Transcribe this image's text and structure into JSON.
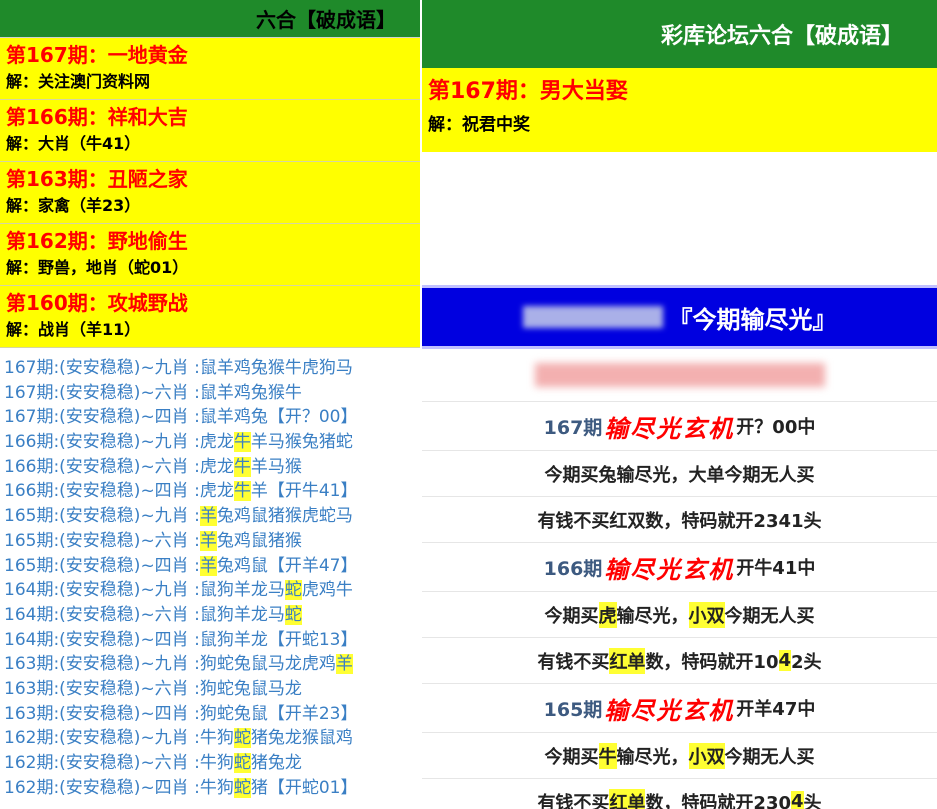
{
  "left": {
    "header": "六合【破成语】",
    "riddles": [
      {
        "title": "第167期：一地黄金",
        "answer": "解：关注澳门资料网"
      },
      {
        "title": "第166期：祥和大吉",
        "answer": "解：大肖（牛41）"
      },
      {
        "title": "第163期：丑陋之家",
        "answer": "解：家禽（羊23）"
      },
      {
        "title": "第162期：野地偷生",
        "answer": "解：野兽，地肖（蛇01）"
      },
      {
        "title": "第160期：攻城野战",
        "answer": "解：战肖（羊11）"
      }
    ],
    "list": [
      {
        "prefix": "167期:(安安稳稳)~九肖 :",
        "segments": [
          {
            "t": "鼠羊鸡兔猴牛虎狗马",
            "h": false
          }
        ]
      },
      {
        "prefix": "167期:(安安稳稳)~六肖 :",
        "segments": [
          {
            "t": "鼠羊鸡兔猴牛",
            "h": false
          }
        ]
      },
      {
        "prefix": "167期:(安安稳稳)~四肖 :",
        "segments": [
          {
            "t": "鼠羊鸡兔【开？00】",
            "h": false
          }
        ]
      },
      {
        "prefix": "166期:(安安稳稳)~九肖 :",
        "segments": [
          {
            "t": "虎龙",
            "h": false
          },
          {
            "t": "牛",
            "h": true
          },
          {
            "t": "羊马猴兔猪蛇",
            "h": false
          }
        ]
      },
      {
        "prefix": "166期:(安安稳稳)~六肖 :",
        "segments": [
          {
            "t": "虎龙",
            "h": false
          },
          {
            "t": "牛",
            "h": true
          },
          {
            "t": "羊马猴",
            "h": false
          }
        ]
      },
      {
        "prefix": "166期:(安安稳稳)~四肖 :",
        "segments": [
          {
            "t": "虎龙",
            "h": false
          },
          {
            "t": "牛",
            "h": true
          },
          {
            "t": "羊【开牛41】",
            "h": false
          }
        ]
      },
      {
        "prefix": "165期:(安安稳稳)~九肖 :",
        "segments": [
          {
            "t": "羊",
            "h": true
          },
          {
            "t": "兔鸡鼠猪猴虎蛇马",
            "h": false
          }
        ]
      },
      {
        "prefix": "165期:(安安稳稳)~六肖 :",
        "segments": [
          {
            "t": "羊",
            "h": true
          },
          {
            "t": "兔鸡鼠猪猴",
            "h": false
          }
        ]
      },
      {
        "prefix": "165期:(安安稳稳)~四肖 :",
        "segments": [
          {
            "t": "羊",
            "h": true
          },
          {
            "t": "兔鸡鼠【开羊47】",
            "h": false
          }
        ]
      },
      {
        "prefix": "164期:(安安稳稳)~九肖 :",
        "segments": [
          {
            "t": "鼠狗羊龙马",
            "h": false
          },
          {
            "t": "蛇",
            "h": true
          },
          {
            "t": "虎鸡牛",
            "h": false
          }
        ]
      },
      {
        "prefix": "164期:(安安稳稳)~六肖 :",
        "segments": [
          {
            "t": "鼠狗羊龙马",
            "h": false
          },
          {
            "t": "蛇",
            "h": true
          }
        ]
      },
      {
        "prefix": "164期:(安安稳稳)~四肖 :",
        "segments": [
          {
            "t": "鼠狗羊龙【开蛇13】",
            "h": false
          }
        ]
      },
      {
        "prefix": "163期:(安安稳稳)~九肖 :",
        "segments": [
          {
            "t": "狗蛇兔鼠马龙虎鸡",
            "h": false
          },
          {
            "t": "羊",
            "h": true
          }
        ]
      },
      {
        "prefix": "163期:(安安稳稳)~六肖 :",
        "segments": [
          {
            "t": "狗蛇兔鼠马龙",
            "h": false
          }
        ]
      },
      {
        "prefix": "163期:(安安稳稳)~四肖 :",
        "segments": [
          {
            "t": "狗蛇兔鼠【开羊23】",
            "h": false
          }
        ]
      },
      {
        "prefix": "162期:(安安稳稳)~九肖 :",
        "segments": [
          {
            "t": "牛狗",
            "h": false
          },
          {
            "t": "蛇",
            "h": true
          },
          {
            "t": "猪兔龙猴鼠鸡",
            "h": false
          }
        ]
      },
      {
        "prefix": "162期:(安安稳稳)~六肖 :",
        "segments": [
          {
            "t": "牛狗",
            "h": false
          },
          {
            "t": "蛇",
            "h": true
          },
          {
            "t": "猪兔龙",
            "h": false
          }
        ]
      },
      {
        "prefix": "162期:(安安稳稳)~四肖 :",
        "segments": [
          {
            "t": "牛狗",
            "h": false
          },
          {
            "t": "蛇",
            "h": true
          },
          {
            "t": "猪【开蛇01】",
            "h": false
          }
        ]
      }
    ]
  },
  "right": {
    "header": "彩库论坛六合【破成语】",
    "riddle": {
      "title": "第167期：男大当娶",
      "answer": "解：祝君中奖"
    },
    "banner": "『今期输尽光』",
    "keyword": "输尽光玄机",
    "entries": [
      {
        "period": "167期",
        "result": "开？00中",
        "line1": [
          {
            "t": "今期买兔输尽光，大单今期无人买",
            "h": false
          }
        ],
        "line2": [
          {
            "t": "有钱不买红双数，特码就开2341头",
            "h": false
          }
        ]
      },
      {
        "period": "166期",
        "result": "开牛41中",
        "line1": [
          {
            "t": "今期买",
            "h": false
          },
          {
            "t": "虎",
            "h": true
          },
          {
            "t": "输尽光，",
            "h": false
          },
          {
            "t": "小双",
            "h": true
          },
          {
            "t": "今期无人买",
            "h": false
          }
        ],
        "line2": [
          {
            "t": "有钱不买",
            "h": false
          },
          {
            "t": "红单",
            "h": true
          },
          {
            "t": "数，特码就开10",
            "h": false
          },
          {
            "t": "4",
            "h": true
          },
          {
            "t": "2头",
            "h": false
          }
        ]
      },
      {
        "period": "165期",
        "result": "开羊47中",
        "line1": [
          {
            "t": "今期买",
            "h": false
          },
          {
            "t": "牛",
            "h": true
          },
          {
            "t": "输尽光，",
            "h": false
          },
          {
            "t": "小双",
            "h": true
          },
          {
            "t": "今期无人买",
            "h": false
          }
        ],
        "line2": [
          {
            "t": "有钱不买",
            "h": false
          },
          {
            "t": "红单",
            "h": true
          },
          {
            "t": "数，特码就开230",
            "h": false
          },
          {
            "t": "4",
            "h": true
          },
          {
            "t": "头",
            "h": false
          }
        ]
      }
    ]
  }
}
